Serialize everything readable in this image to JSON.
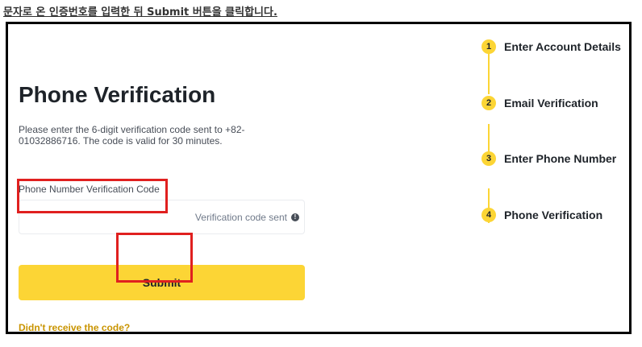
{
  "instruction": "문자로 온 인증번호를 입력한 뒤 Submit 버튼을 클릭합니다.",
  "form": {
    "title": "Phone Verification",
    "description": "Please enter the 6-digit verification code sent to +82-01032886716. The code is valid for 30 minutes.",
    "field_label": "Phone Number Verification Code",
    "code_value": "",
    "code_sent_label": "Verification code sent",
    "submit_label": "Submit",
    "resend_link": "Didn't receive the code?"
  },
  "steps": [
    {
      "number": "1",
      "label": "Enter Account Details"
    },
    {
      "number": "2",
      "label": "Email Verification"
    },
    {
      "number": "3",
      "label": "Enter Phone Number"
    },
    {
      "number": "4",
      "label": "Phone Verification"
    }
  ],
  "colors": {
    "accent": "#fcd535",
    "highlight": "#e0201f",
    "link": "#c99400"
  }
}
